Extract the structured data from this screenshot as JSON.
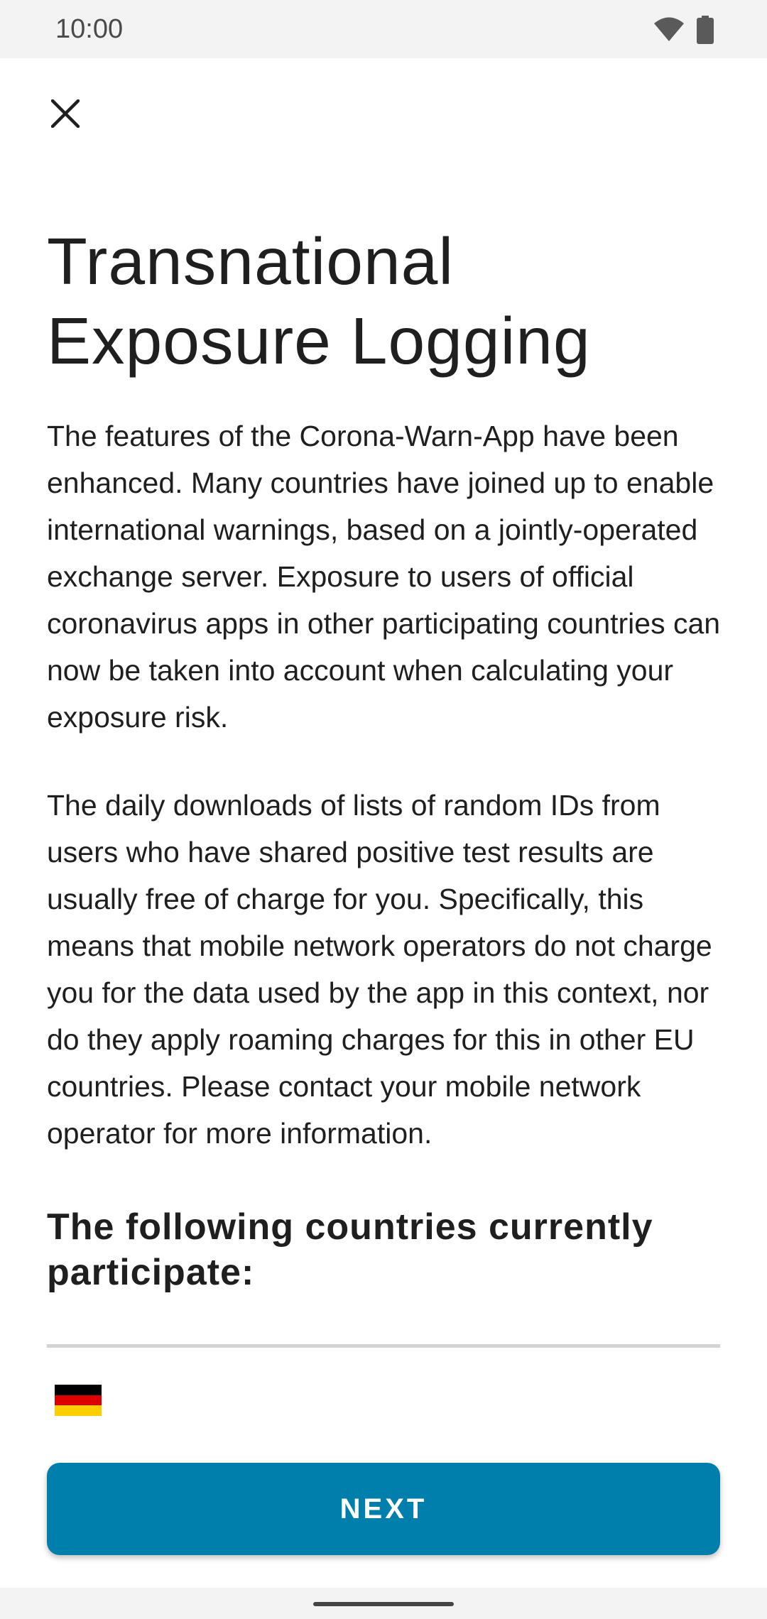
{
  "status_bar": {
    "time": "10:00",
    "icons": [
      "wifi-icon",
      "battery-icon"
    ]
  },
  "header": {
    "close_icon": "close-icon"
  },
  "content": {
    "title_line1": "Transnational",
    "title_line2": "Exposure Logging",
    "paragraph1": "The features of the Corona-Warn-App have been enhanced. Many countries have joined up to enable international warnings, based on a jointly-operated exchange server. Exposure to users of official coronavirus apps in other participating countries can now be taken into account when calculating your exposure risk.",
    "paragraph2": "The daily downloads of lists of random IDs from users who have shared positive test results are usually free of charge for you. Specifically, this means that mobile network operators do not charge you for the data used by the app in this context, nor do they apply roaming charges for this in other EU countries. Please contact your mobile network operator for more information.",
    "countries_heading": "The following countries currently participate:",
    "countries": [
      {
        "flag": "germany-flag-icon",
        "colors": [
          "#000000",
          "#dd0000",
          "#ffce00"
        ]
      }
    ]
  },
  "footer": {
    "next_label": "NEXT"
  },
  "colors": {
    "accent": "#007fad",
    "text": "#1f1f1f",
    "divider": "#d3d3d3",
    "system_bar": "#f3f3f3"
  }
}
